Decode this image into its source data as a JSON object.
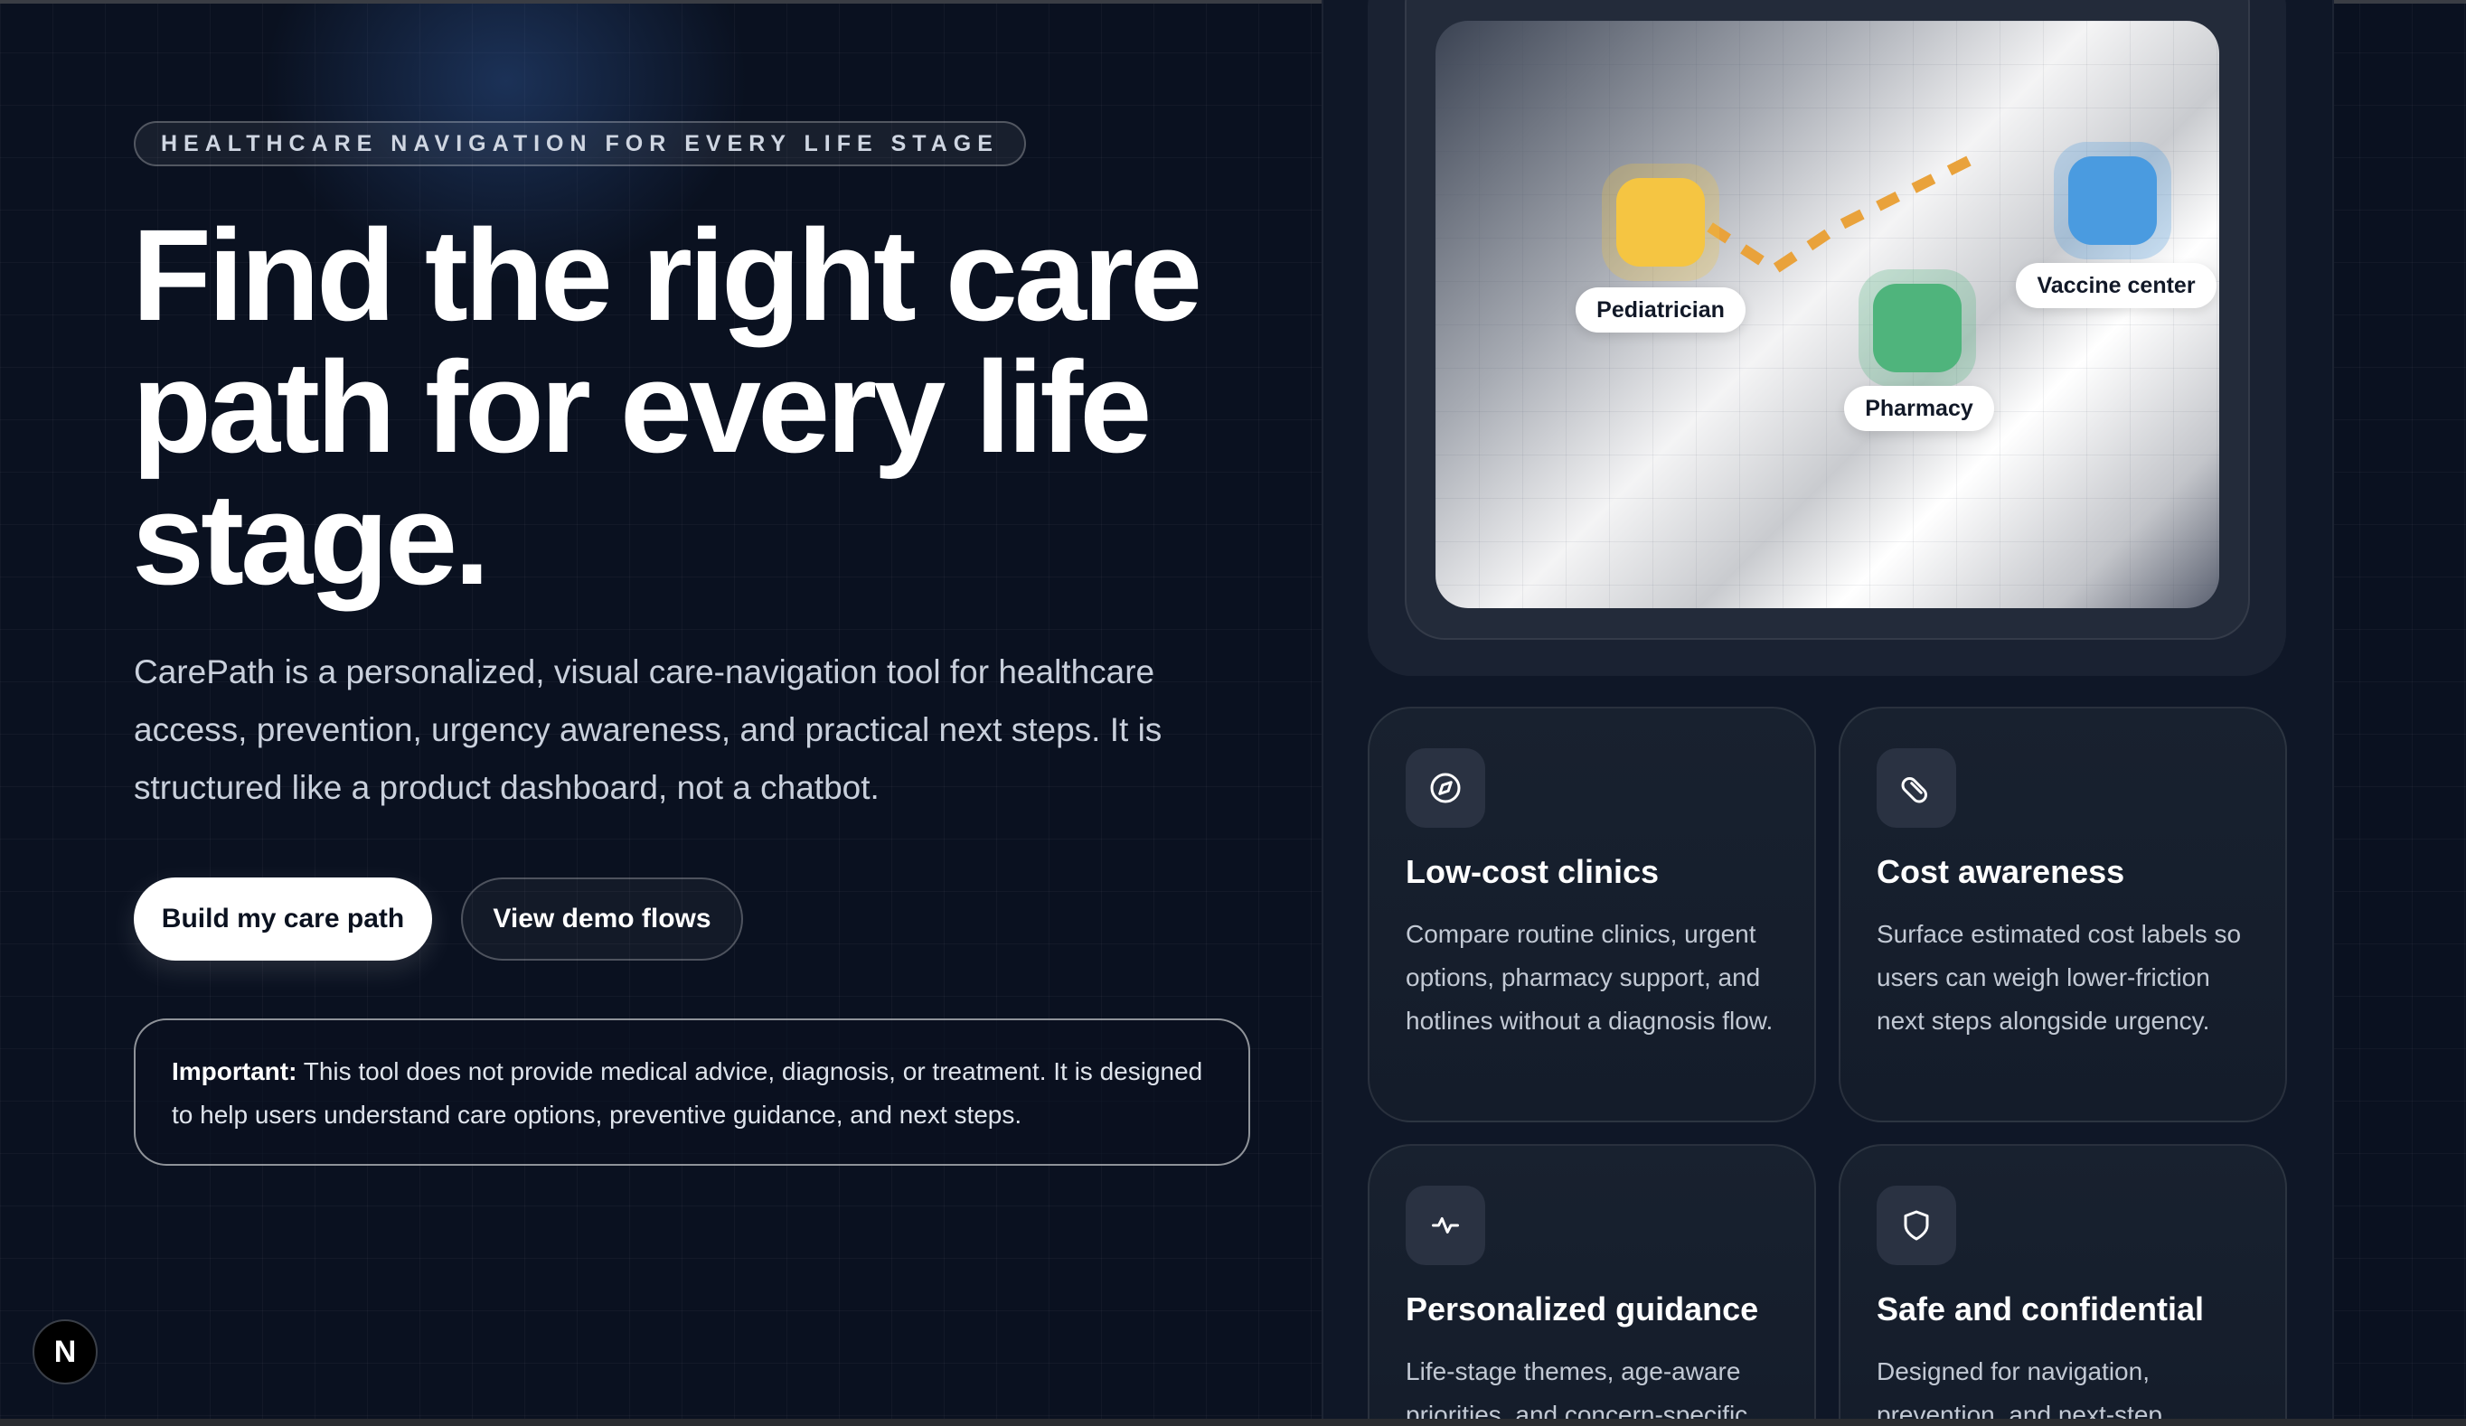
{
  "hero": {
    "eyebrow": "HEALTHCARE NAVIGATION FOR EVERY LIFE STAGE",
    "headline_line1": "Find the right care",
    "headline_line2": "path for every life",
    "headline_line3": "stage.",
    "intro": "CarePath is a personalized, visual care-navigation tool for healthcare access, prevention, urgency awareness, and practical next steps. It is structured like a product dashboard, not a chatbot.",
    "primary_button": "Build my care path",
    "secondary_button": "View demo flows",
    "notice_label": "Important:",
    "notice_text": " This tool does not provide medical advice, diagnosis, or treatment. It is designed to help users understand care options, preventive guidance, and next steps."
  },
  "map": {
    "pins": [
      {
        "label": "Pediatrician",
        "color": "#f5c542",
        "icon": "pediatrician-pin"
      },
      {
        "label": "Pharmacy",
        "color": "#4fb47c",
        "icon": "pharmacy-pin"
      },
      {
        "label": "Vaccine center",
        "color": "#4a9be0",
        "icon": "vaccine-center-pin"
      }
    ],
    "route_color": "#e9a23b"
  },
  "features": [
    {
      "icon": "compass-icon",
      "title": "Low-cost clinics",
      "body": "Compare routine clinics, urgent options, pharmacy support, and hotlines without a diagnosis flow."
    },
    {
      "icon": "pill-icon",
      "title": "Cost awareness",
      "body": "Surface estimated cost labels so users can weigh lower-friction next steps alongside urgency."
    },
    {
      "icon": "pulse-icon",
      "title": "Personalized guidance",
      "body": "Life-stage themes, age-aware priorities, and concern-specific"
    },
    {
      "icon": "shield-icon",
      "title": "Safe and confidential",
      "body": "Designed for navigation, prevention, and next-step"
    }
  ],
  "framework_badge": "N",
  "colors": {
    "background": "#0a1120",
    "panel": "#0f1727",
    "card": "#18212f",
    "accent_route": "#e9a23b"
  }
}
